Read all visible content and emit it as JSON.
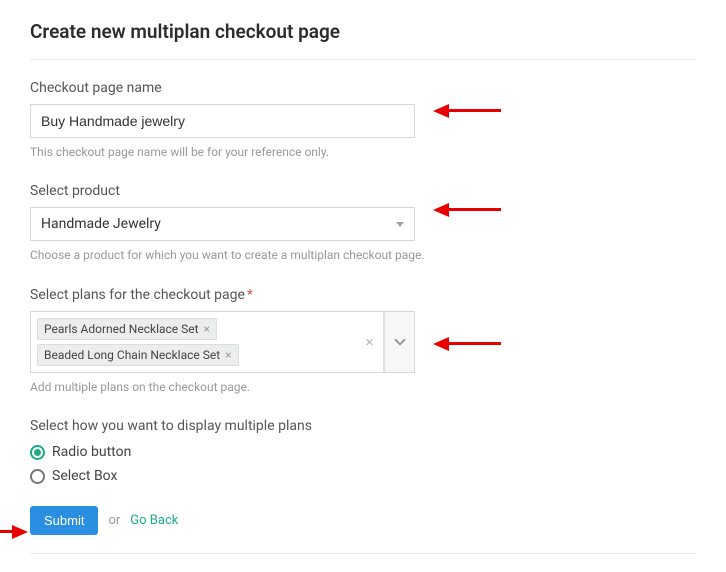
{
  "title": "Create new multiplan checkout page",
  "fields": {
    "name": {
      "label": "Checkout page name",
      "value": "Buy Handmade jewelry",
      "helper": "This checkout page name will be for your reference only."
    },
    "product": {
      "label": "Select product",
      "selected": "Handmade Jewelry",
      "helper": "Choose a product for which you want to create a multiplan checkout page."
    },
    "plans": {
      "label": "Select plans for the checkout page",
      "required": "*",
      "tags": [
        "Pearls Adorned Necklace Set",
        "Beaded Long Chain Necklace Set"
      ],
      "helper": "Add multiple plans on the checkout page."
    },
    "display": {
      "label": "Select how you want to display multiple plans",
      "options": [
        {
          "label": "Radio button",
          "selected": true
        },
        {
          "label": "Select Box",
          "selected": false
        }
      ]
    }
  },
  "actions": {
    "submit": "Submit",
    "or": "or",
    "goback": "Go Back"
  },
  "glyph": {
    "x": "×"
  }
}
